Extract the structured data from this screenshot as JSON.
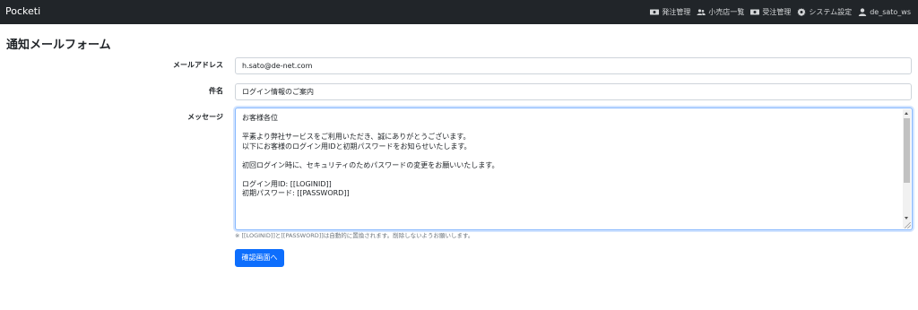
{
  "navbar": {
    "brand": "Pocketi",
    "items": [
      {
        "label": "発注管理",
        "icon": "money-bill-icon"
      },
      {
        "label": "小売店一覧",
        "icon": "users-icon"
      },
      {
        "label": "受注管理",
        "icon": "money-bill-icon"
      },
      {
        "label": "システム設定",
        "icon": "gear-icon"
      },
      {
        "label": "de_sato_ws",
        "icon": "user-icon"
      }
    ]
  },
  "page": {
    "title": "通知メールフォーム"
  },
  "form": {
    "email_label": "メールアドレス",
    "email_value": "h.sato@de-net.com",
    "subject_label": "件名",
    "subject_value": "ログイン情報のご案内",
    "message_label": "メッセージ",
    "message_lines": [
      "お客様各位",
      "",
      "平素より弊社サービスをご利用いただき、誠にありがとうございます。",
      "以下にお客様のログイン用IDと初期パスワードをお知らせいたします。",
      "",
      "初回ログイン時に、セキュリティのためパスワードの変更をお願いいたします。",
      "",
      "ログイン用ID: [[LOGINID]]",
      "初期パスワード: [[PASSWORD]]"
    ],
    "help_text": "※ [[LOGINID]]と[[PASSWORD]]は自動的に置換されます。削除しないようお願いします。",
    "confirm_button": "確認画面へ"
  },
  "colors": {
    "navbar_bg": "#212529",
    "primary": "#0d6efd"
  }
}
